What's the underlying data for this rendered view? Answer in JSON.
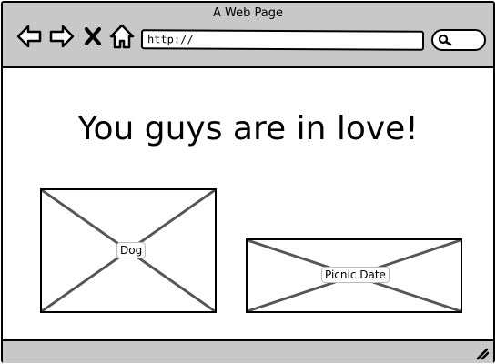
{
  "window": {
    "title": "A Web Page"
  },
  "toolbar": {
    "url": "http://",
    "icons": [
      "back-arrow-icon",
      "forward-arrow-icon",
      "close-x-icon",
      "home-icon",
      "search-icon"
    ]
  },
  "main": {
    "heading": "You guys are in love!",
    "images": [
      {
        "label": "Dog"
      },
      {
        "label": "Picnic Date"
      }
    ]
  },
  "colors": {
    "chrome": "#c8c8c8",
    "stroke": "#000000",
    "placeholder_line": "#555555"
  }
}
